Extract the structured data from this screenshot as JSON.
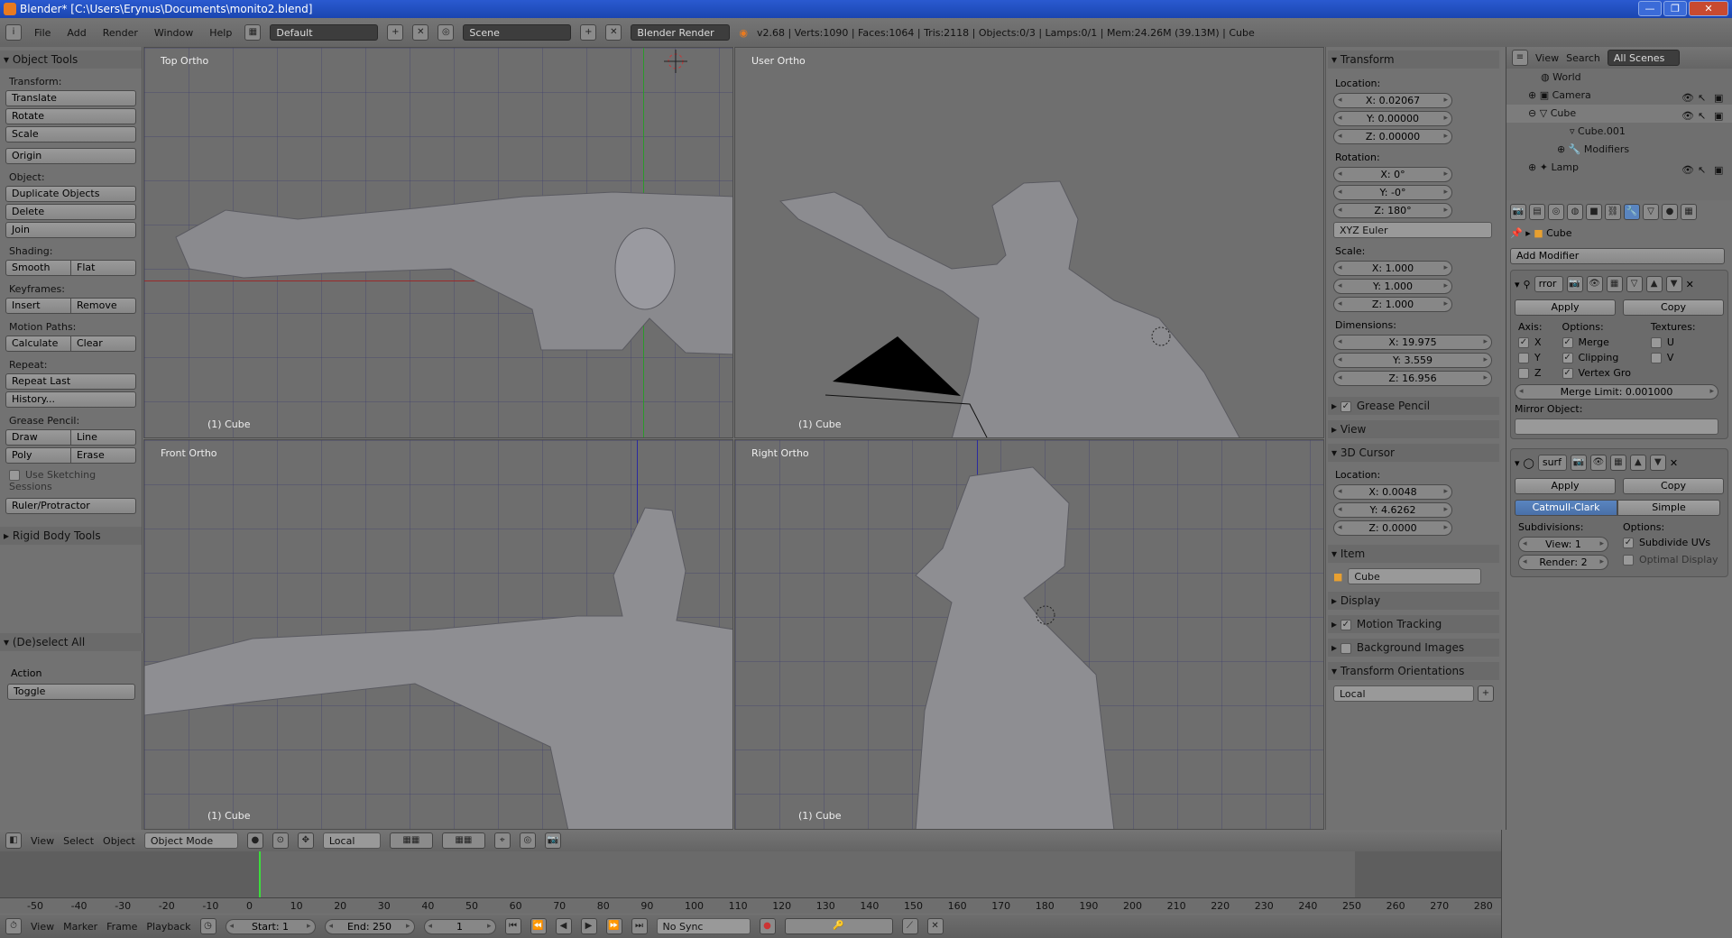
{
  "window": {
    "title": "Blender* [C:\\Users\\Erynus\\Documents\\monito2.blend]",
    "buttons": [
      "—",
      "❐",
      "✕"
    ]
  },
  "info_header": {
    "menus": [
      "File",
      "Add",
      "Render",
      "Window",
      "Help"
    ],
    "layout": "Default",
    "scene": "Scene",
    "engine": "Blender Render",
    "stats": "v2.68 | Verts:1090 | Faces:1064 | Tris:2118 | Objects:0/3 | Lamps:0/1 | Mem:24.26M (39.13M) | Cube"
  },
  "tool_shelf": {
    "title": "Object Tools",
    "transform_label": "Transform:",
    "translate": "Translate",
    "rotate": "Rotate",
    "scale": "Scale",
    "origin": "Origin",
    "object_label": "Object:",
    "duplicate": "Duplicate Objects",
    "delete": "Delete",
    "join": "Join",
    "shading_label": "Shading:",
    "smooth": "Smooth",
    "flat": "Flat",
    "keyframes_label": "Keyframes:",
    "insert": "Insert",
    "remove": "Remove",
    "motion_label": "Motion Paths:",
    "calculate": "Calculate",
    "clear": "Clear",
    "repeat_label": "Repeat:",
    "repeat_last": "Repeat Last",
    "history": "History...",
    "grease_label": "Grease Pencil:",
    "draw": "Draw",
    "line": "Line",
    "poly": "Poly",
    "erase": "Erase",
    "sketching": "Use Sketching Sessions",
    "ruler": "Ruler/Protractor",
    "rigid_body": "Rigid Body Tools",
    "deselect_title": "(De)select All",
    "action_label": "Action",
    "action_value": "Toggle"
  },
  "viewports": {
    "top": {
      "title": "Top Ortho",
      "object": "(1) Cube"
    },
    "user": {
      "title": "User Ortho",
      "object": "(1) Cube"
    },
    "front": {
      "title": "Front Ortho",
      "object": "(1) Cube"
    },
    "right": {
      "title": "Right Ortho",
      "object": "(1) Cube"
    }
  },
  "props_panel": {
    "transform_title": "Transform",
    "location_label": "Location:",
    "loc_x": "X: 0.02067",
    "loc_y": "Y: 0.00000",
    "loc_z": "Z: 0.00000",
    "rotation_label": "Rotation:",
    "rot_x": "X: 0°",
    "rot_y": "Y: -0°",
    "rot_z": "Z: 180°",
    "rotation_mode": "XYZ Euler",
    "scale_label": "Scale:",
    "sc_x": "X: 1.000",
    "sc_y": "Y: 1.000",
    "sc_z": "Z: 1.000",
    "dimensions_label": "Dimensions:",
    "dim_x": "X: 19.975",
    "dim_y": "Y: 3.559",
    "dim_z": "Z: 16.956",
    "grease_pencil": "Grease Pencil",
    "view": "View",
    "cursor_title": "3D Cursor",
    "cursor_location": "Location:",
    "cur_x": "X: 0.0048",
    "cur_y": "Y: 4.6262",
    "cur_z": "Z: 0.0000",
    "item_title": "Item",
    "item_name": "Cube",
    "display": "Display",
    "motion_tracking": "Motion Tracking",
    "background_images": "Background Images",
    "transform_orientations": "Transform Orientations",
    "orientation_value": "Local"
  },
  "outliner": {
    "view": "View",
    "search": "Search",
    "scope": "All Scenes",
    "rows": [
      "World",
      "Camera",
      "Cube",
      "Cube.001",
      "Modifiers",
      "Lamp"
    ]
  },
  "properties": {
    "breadcrumb": "Cube",
    "add_modifier": "Add Modifier",
    "mod1": {
      "name": "rror",
      "apply": "Apply",
      "copy": "Copy",
      "axis_label": "Axis:",
      "options_label": "Options:",
      "textures_label": "Textures:",
      "ax_x": "X",
      "ax_y": "Y",
      "ax_z": "Z",
      "merge": "Merge",
      "clipping": "Clipping",
      "vertex_gro": "Vertex Gro",
      "tex_u": "U",
      "tex_v": "V",
      "merge_limit": "Merge Limit: 0.001000",
      "mirror_object": "Mirror Object:"
    },
    "mod2": {
      "name": "surf",
      "apply": "Apply",
      "copy": "Copy",
      "catmull": "Catmull-Clark",
      "simple": "Simple",
      "subdiv_label": "Subdivisions:",
      "options_label": "Options:",
      "view_level": "View: 1",
      "render_level": "Render: 2",
      "subdivide_uvs": "Subdivide UVs",
      "optimal_display": "Optimal Display"
    }
  },
  "view3d_header": {
    "menus": [
      "View",
      "Select",
      "Object"
    ],
    "mode": "Object Mode",
    "orientation": "Local"
  },
  "timeline": {
    "ticks": [
      "-50",
      "-40",
      "-30",
      "-20",
      "-10",
      "0",
      "10",
      "20",
      "30",
      "40",
      "50",
      "60",
      "70",
      "80",
      "90",
      "100",
      "110",
      "120",
      "130",
      "140",
      "150",
      "160",
      "170",
      "180",
      "190",
      "200",
      "210",
      "220",
      "230",
      "240",
      "250",
      "260",
      "270",
      "280"
    ],
    "current_frame": "1"
  },
  "footer": {
    "menus": [
      "View",
      "Marker",
      "Frame",
      "Playback"
    ],
    "start": "Start: 1",
    "end": "End: 250",
    "frame": "1",
    "sync": "No Sync"
  },
  "colors": {
    "accent_blue": "#4a70a8",
    "playhead_green": "#3cdc3c",
    "titlebar_blue": "#2a5ad0"
  }
}
